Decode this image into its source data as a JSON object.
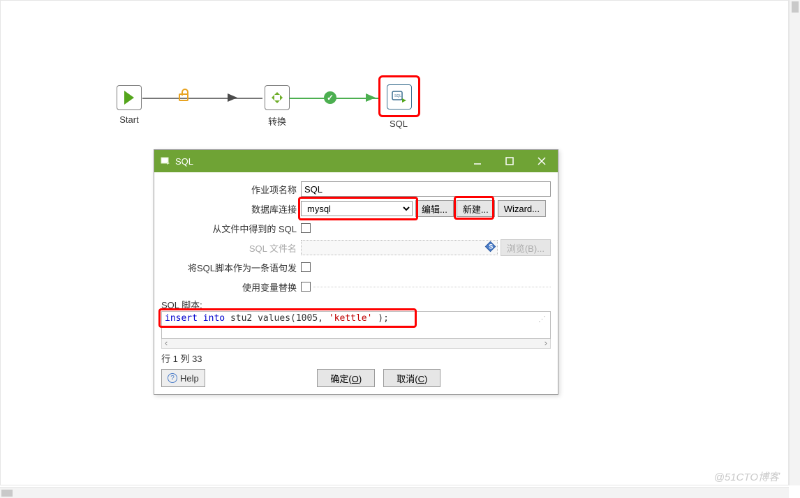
{
  "watermark": "@51CTO博客",
  "flow": {
    "start_label": "Start",
    "transform_label": "转换",
    "sql_label": "SQL"
  },
  "dialog": {
    "title": "SQL",
    "labels": {
      "job_name": "作业项名称",
      "db_conn": "数据库连接",
      "sql_from_file": "从文件中得到的 SQL",
      "sql_filename": "SQL 文件名",
      "single_stmt": "将SQL脚本作为一条语句发",
      "var_replace": "使用变量替换",
      "sql_script": "SQL 脚本:",
      "position": "行 1 列 33"
    },
    "values": {
      "job_name": "SQL",
      "db_conn": "mysql"
    },
    "buttons": {
      "edit": "编辑...",
      "new": "新建...",
      "wizard": "Wizard...",
      "browse": "浏览(B)...",
      "help": "Help",
      "ok": "确定(O)",
      "cancel": "取消(C)"
    },
    "sql": {
      "insert": "insert",
      "into": "into",
      "mid": " stu2 values(1005,",
      "str": "'kettle'",
      "end": ");"
    }
  }
}
